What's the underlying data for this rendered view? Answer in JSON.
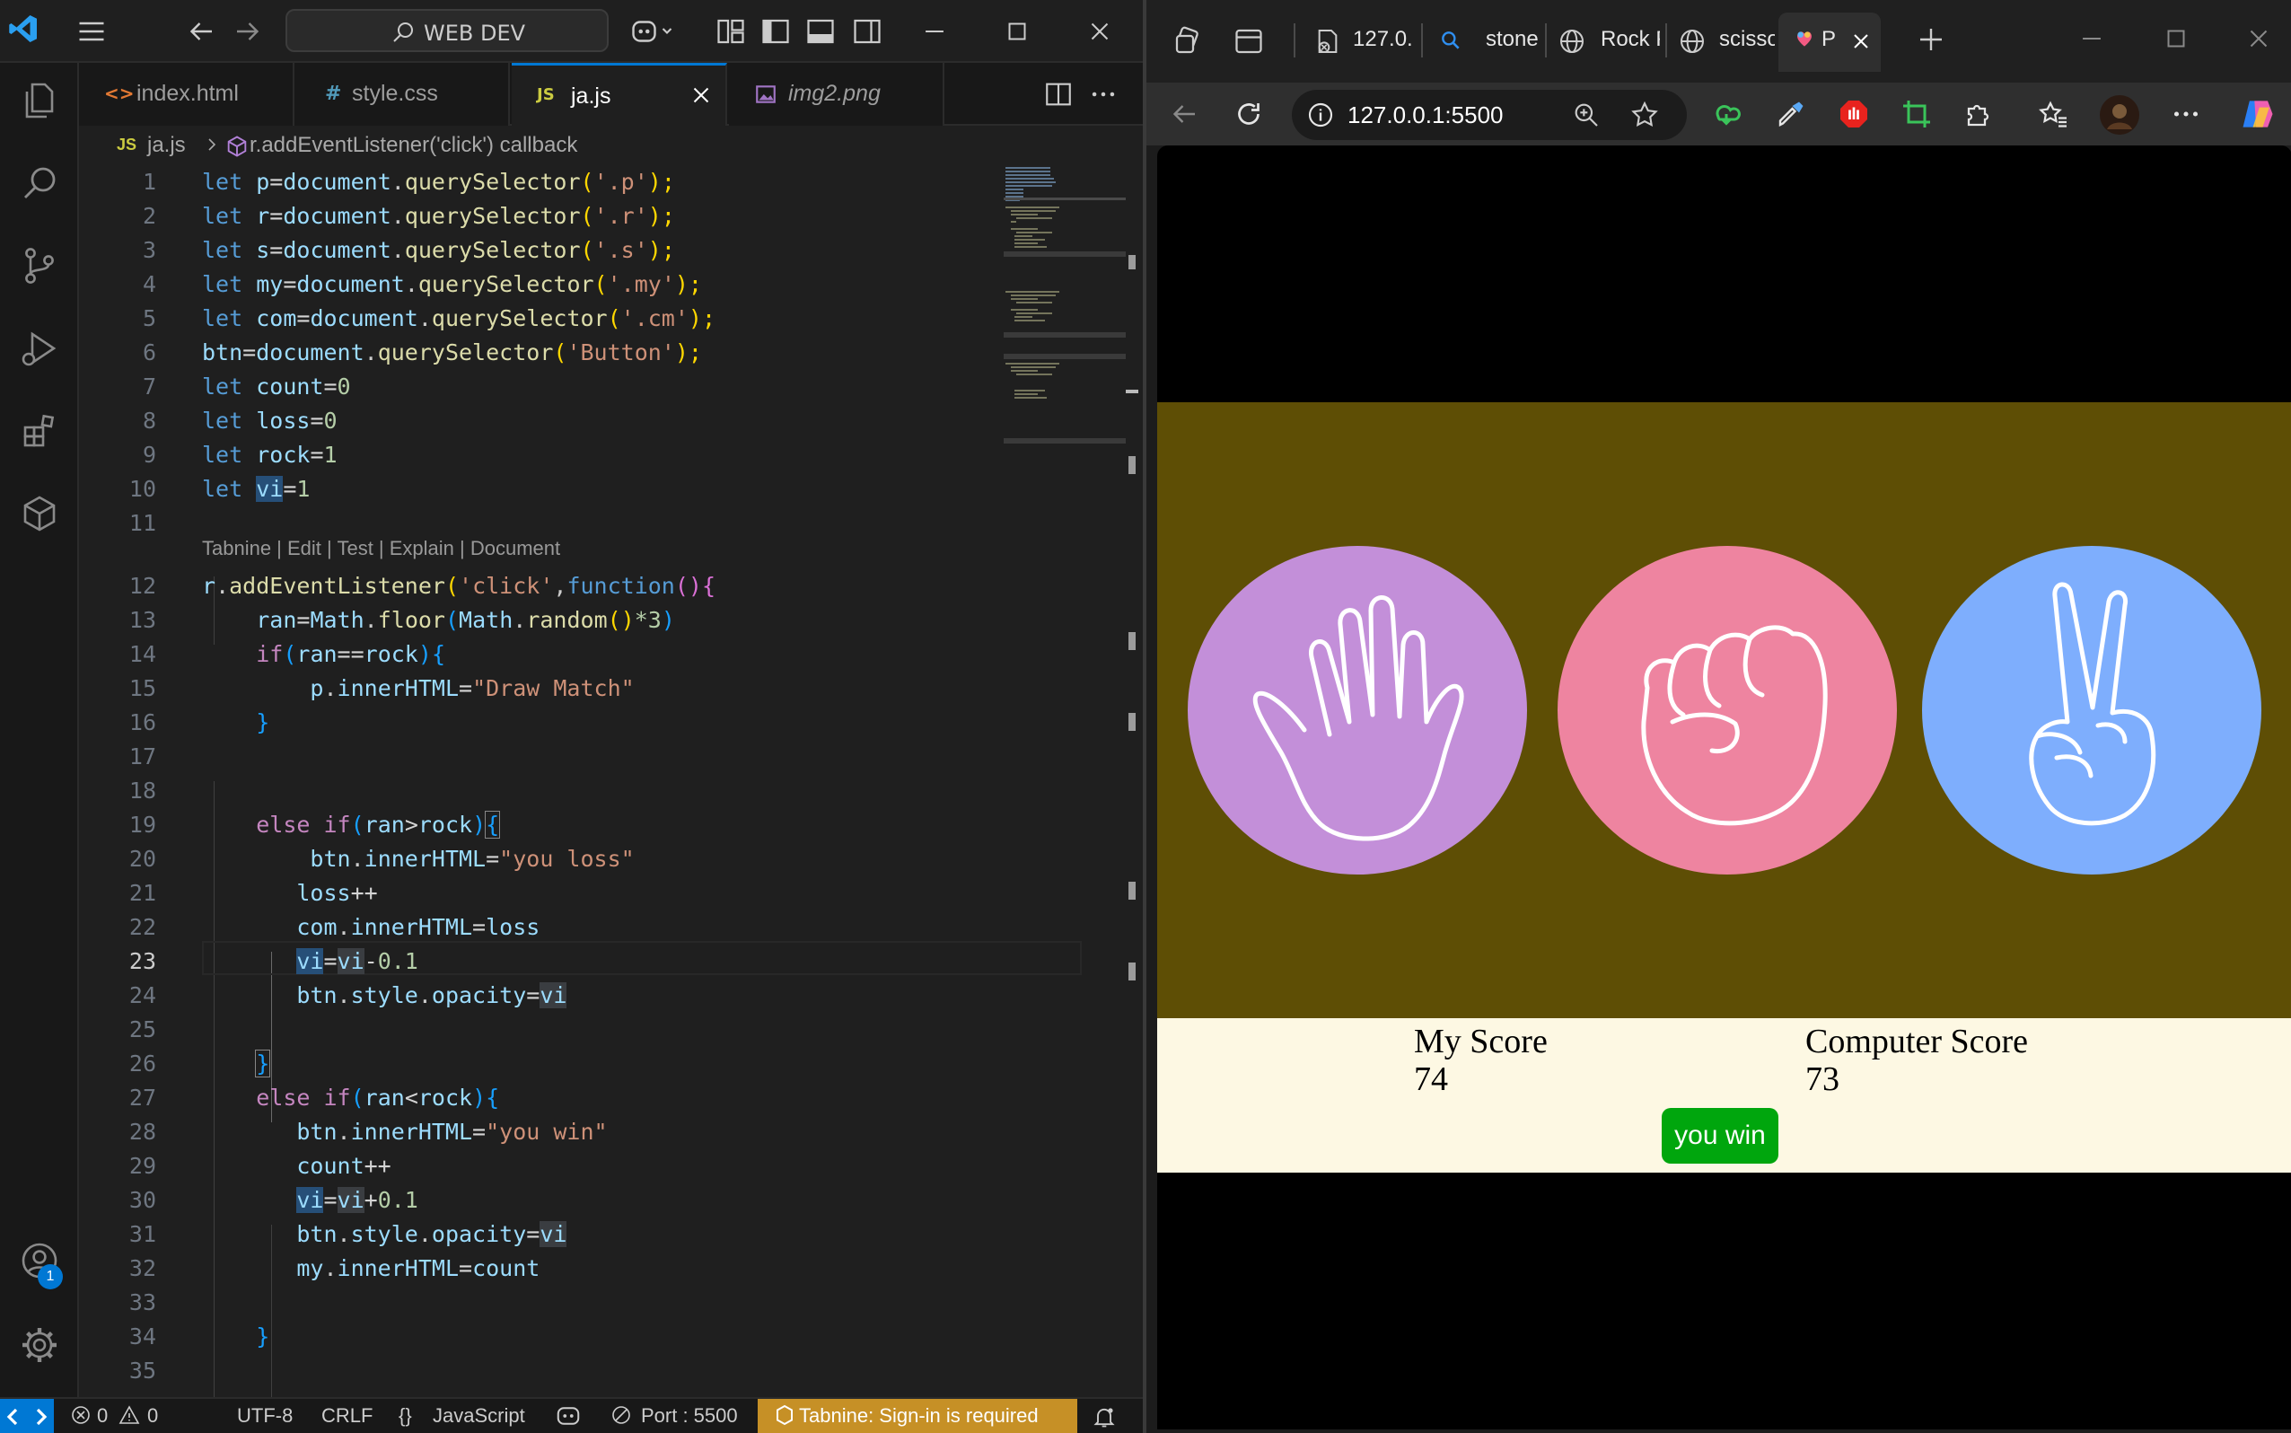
{
  "vscode": {
    "search_label": "WEB DEV",
    "tabs": [
      {
        "icon": "<>",
        "label": "index.html"
      },
      {
        "icon": "#",
        "label": "style.css"
      },
      {
        "icon": "JS",
        "label": "ja.js"
      },
      {
        "icon": "img",
        "label": "img2.png"
      }
    ],
    "breadcrumb": {
      "file_icon": "JS",
      "file": "ja.js",
      "symbol": "r.addEventListener('click') callback"
    },
    "line_numbers": [
      "1",
      "2",
      "3",
      "4",
      "5",
      "6",
      "7",
      "8",
      "9",
      "10",
      "11",
      "12",
      "13",
      "14",
      "15",
      "16",
      "17",
      "18",
      "19",
      "20",
      "21",
      "22",
      "23",
      "24",
      "25",
      "26",
      "27",
      "28",
      "29",
      "30",
      "31",
      "32",
      "33",
      "34",
      "35"
    ],
    "codelens": "Tabnine | Edit | Test | Explain | Document",
    "code": {
      "l1": [
        "let ",
        "p",
        "=",
        "document",
        ".",
        "querySelector",
        "(",
        "'.p'",
        ");"
      ],
      "l2": [
        "let ",
        "r",
        "=",
        "document",
        ".",
        "querySelector",
        "(",
        "'.r'",
        ");"
      ],
      "l3": [
        "let ",
        "s",
        "=",
        "document",
        ".",
        "querySelector",
        "(",
        "'.s'",
        ");"
      ],
      "l4": [
        "let ",
        "my",
        "=",
        "document",
        ".",
        "querySelector",
        "(",
        "'.my'",
        ");"
      ],
      "l5": [
        "let ",
        "com",
        "=",
        "document",
        ".",
        "querySelector",
        "(",
        "'.cm'",
        ");"
      ],
      "l6": [
        "btn",
        "=",
        "document",
        ".",
        "querySelector",
        "(",
        "'Button'",
        ");"
      ],
      "l7": [
        "let ",
        "count",
        "=",
        "0"
      ],
      "l8": [
        "let ",
        "loss",
        "=",
        "0"
      ],
      "l9": [
        "let ",
        "rock",
        "=",
        "1"
      ],
      "l10": [
        "let ",
        "vi",
        "=",
        "1"
      ],
      "l12": [
        "r",
        ".",
        "addEventListener",
        "(",
        "'click'",
        ",",
        "function",
        "()",
        "{"
      ],
      "l13": [
        "    ",
        "ran",
        "=",
        "Math",
        ".",
        "floor",
        "(",
        "Math",
        ".",
        "random",
        "()",
        "*3",
        ")"
      ],
      "l14": [
        "    ",
        "if",
        "(",
        "ran",
        "==",
        "rock",
        ")",
        "{"
      ],
      "l15": [
        "        ",
        "p",
        ".",
        "innerHTML",
        "=",
        "\"Draw Match\""
      ],
      "l16": [
        "    ",
        "}"
      ],
      "l18": [
        "    ",
        "else ",
        "if",
        "(",
        "ran",
        ">",
        "rock",
        ")",
        "{"
      ],
      "l19": [
        "        ",
        "btn",
        ".",
        "innerHTML",
        "=",
        "\"you loss\""
      ],
      "l20": [
        "       ",
        "loss",
        "++"
      ],
      "l21": [
        "       ",
        "com",
        ".",
        "innerHTML",
        "=",
        "loss"
      ],
      "l22": [
        "       ",
        "vi",
        "=",
        "vi",
        "-",
        "0.1"
      ],
      "l23": [
        "       ",
        "btn",
        ".",
        "style",
        ".",
        "opacity",
        "=",
        "vi"
      ],
      "l25": [
        "    ",
        "}"
      ],
      "l26": [
        "    ",
        "else ",
        "if",
        "(",
        "ran",
        "<",
        "rock",
        ")",
        "{"
      ],
      "l27": [
        "       ",
        "btn",
        ".",
        "innerHTML",
        "=",
        "\"you win\""
      ],
      "l28": [
        "       ",
        "count",
        "++"
      ],
      "l29": [
        "       ",
        "vi",
        "=",
        "vi",
        "+",
        "0.1"
      ],
      "l30": [
        "       ",
        "btn",
        ".",
        "style",
        ".",
        "opacity",
        "=",
        "vi"
      ],
      "l31": [
        "       ",
        "my",
        ".",
        "innerHTML",
        "=",
        "count"
      ],
      "l33": [
        "    ",
        "}"
      ]
    },
    "status": {
      "errors": "0",
      "warnings": "0",
      "encoding": "UTF-8",
      "eol": "CRLF",
      "lang_icon": "{}",
      "language": "JavaScript",
      "port": "Port : 5500",
      "tabnine": "Tabnine: Sign-in is required",
      "accounts_badge": "1"
    }
  },
  "browser": {
    "tabs": [
      {
        "label": "127.0."
      },
      {
        "label": "stone"
      },
      {
        "label": "Rock P"
      },
      {
        "label": "scisso"
      },
      {
        "label": "P"
      }
    ],
    "url": "127.0.0.1:5500",
    "game": {
      "my_score_label": "My Score",
      "my_score": "74",
      "computer_score_label": "Computer Score",
      "computer_score": "73",
      "result": "you win"
    },
    "colors": {
      "game_bg": "#5e4e05",
      "paper": "#c38fd9",
      "rock": "#ee84a0",
      "scissors": "#7eaefd",
      "score_bg": "#fdf8e3",
      "result_btn": "#00a60d"
    }
  }
}
